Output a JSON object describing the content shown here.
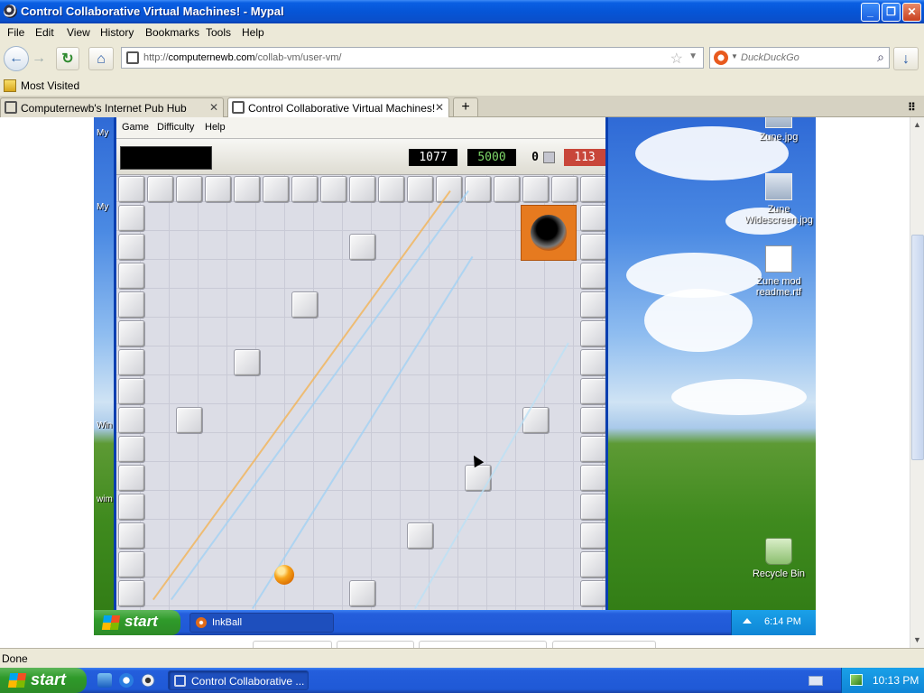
{
  "window": {
    "title": "Control Collaborative Virtual Machines! - Mypal",
    "min_label": "_",
    "max_label": "❐",
    "close_label": "✕"
  },
  "menu": [
    "File",
    "Edit",
    "View",
    "History",
    "Bookmarks",
    "Tools",
    "Help"
  ],
  "nav": {
    "back": "←",
    "forward": "→",
    "reload": "↻",
    "home": "⌂",
    "download": "↓",
    "url_prefix": "http://",
    "url_host": "computernewb.com",
    "url_path": "/collab-vm/user-vm/",
    "star": "☆",
    "search_placeholder": "DuckDuckGo",
    "search_glyph": "⌕"
  },
  "bookmarks": {
    "most_visited": "Most Visited"
  },
  "tabs": [
    {
      "label": "Computernewb's Internet Pub Hub",
      "active": false
    },
    {
      "label": "Control Collaborative Virtual Machines!",
      "active": true
    }
  ],
  "tab_close": "✕",
  "new_tab": "+",
  "tab_list": "⠿",
  "vm": {
    "side_labels": [
      "My",
      "My",
      "Win",
      "wim"
    ],
    "desktop_icons": [
      {
        "label": "Zune.jpg",
        "icon": "image-file-icon"
      },
      {
        "label": "Zune Widescreen.jpg",
        "icon": "image-file-icon"
      },
      {
        "label": "Zune mod readme.rtf",
        "icon": "document-icon"
      },
      {
        "label": "Recycle Bin",
        "icon": "recycle-bin-icon"
      }
    ],
    "inkball": {
      "menu": [
        "Game",
        "Difficulty",
        "Help"
      ],
      "time": "1077",
      "score": "5000",
      "count": "0",
      "goal": "113"
    },
    "taskbar": {
      "start": "start",
      "task": "InkBall",
      "clock": "6:14 PM"
    }
  },
  "status": "Done",
  "taskbar": {
    "start": "start",
    "task": "Control Collaborative ...",
    "clock": "10:13 PM"
  }
}
